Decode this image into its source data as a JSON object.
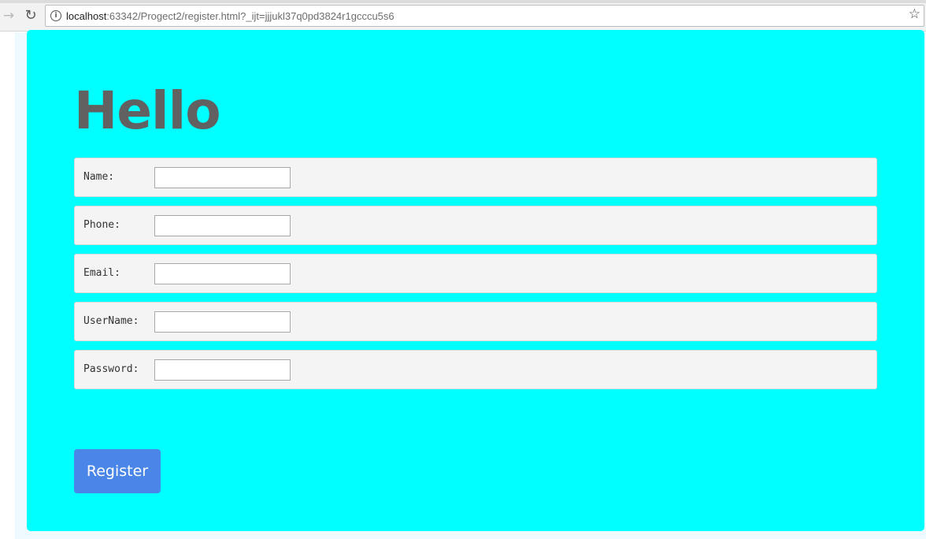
{
  "browser": {
    "url_host": "localhost",
    "url_rest": ":63342/Progect2/register.html?_ijt=jjjukl37q0pd3824r1gcccu5s6",
    "icons": {
      "forward": "arrow-forward-icon",
      "reload": "reload-icon",
      "info": "info-icon",
      "bookmark": "star-icon"
    }
  },
  "page": {
    "heading": "Hello",
    "panel_color": "#00ffff",
    "fields": [
      {
        "label": "Name:",
        "value": ""
      },
      {
        "label": "Phone:",
        "value": ""
      },
      {
        "label": "Email:",
        "value": ""
      },
      {
        "label": "UserName:",
        "value": ""
      },
      {
        "label": "Password:",
        "value": ""
      }
    ],
    "register_label": "Register",
    "button_color": "#4a86e8"
  }
}
